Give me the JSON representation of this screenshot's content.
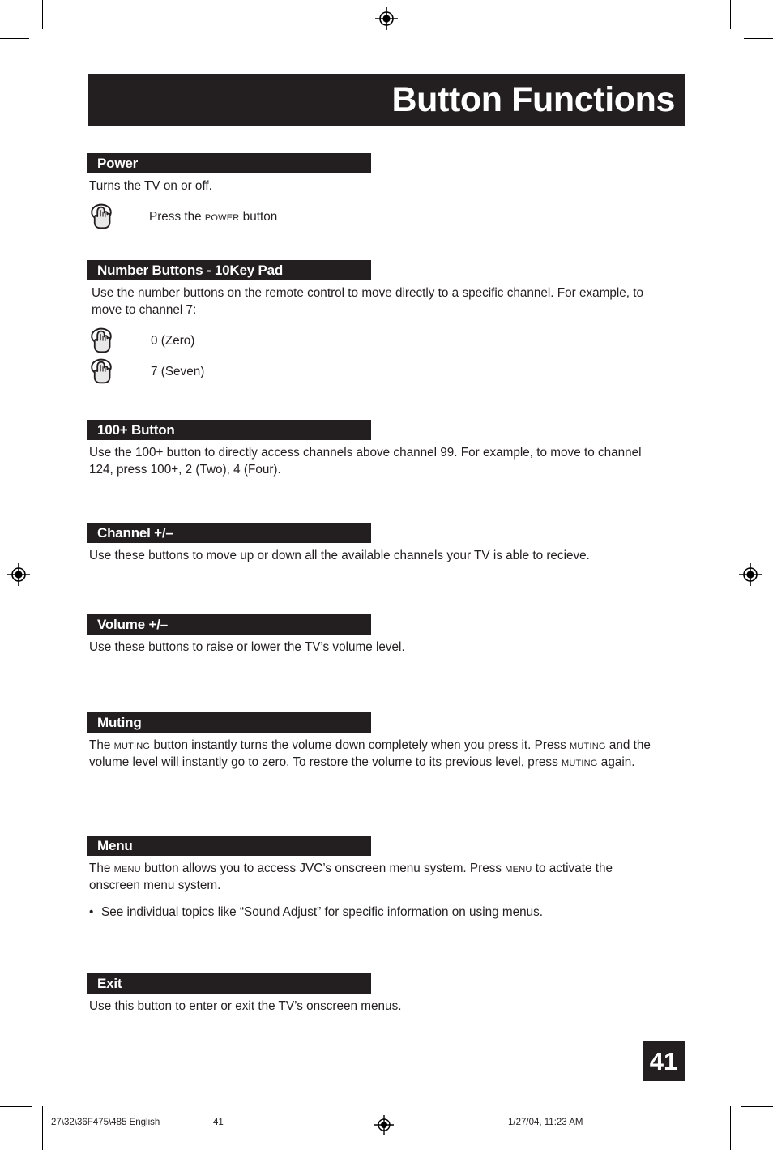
{
  "document": {
    "title": "Button Functions",
    "page_number": "41"
  },
  "sections": [
    {
      "id": "power",
      "heading": "Power",
      "body": "Turns the TV on or off.",
      "press_rows": [
        {
          "icon": "hand-press-icon",
          "label_pre": "Press the ",
          "label_sc": "Power",
          "label_post": " button"
        }
      ]
    },
    {
      "id": "number-buttons",
      "heading": "Number Buttons - 10Key Pad",
      "body": "Use the number buttons on the remote control to move directly to a specific channel. For example, to move to channel 7:",
      "press_rows": [
        {
          "icon": "hand-press-icon",
          "label": "0 (Zero)"
        },
        {
          "icon": "hand-press-icon",
          "label": "7 (Seven)"
        }
      ]
    },
    {
      "id": "hundred-plus-button",
      "heading": "100+ Button",
      "body": "Use the 100+ button to directly access channels above channel 99. For example, to move to channel 124, press 100+, 2 (Two), 4 (Four)."
    },
    {
      "id": "channel-plus-minus",
      "heading": "Channel +/–",
      "body": "Use these buttons to move up or down all the available channels your TV is able to recieve."
    },
    {
      "id": "volume-plus-minus",
      "heading": "Volume +/–",
      "body": "Use these buttons to raise or lower the TV’s volume level."
    },
    {
      "id": "muting",
      "heading": "Muting",
      "body_parts": [
        "The ",
        "Muting",
        " button instantly turns the volume down completely when you press it.  Press ",
        "Muting",
        " and the volume level will instantly go to zero. To restore the volume to its previous level, press ",
        "Muting",
        " again."
      ]
    },
    {
      "id": "menu",
      "heading": "Menu",
      "body_parts": [
        "The ",
        "Menu",
        " button allows you to access JVC’s onscreen menu system. Press ",
        "Menu",
        " to activate the onscreen menu system."
      ],
      "bullet": {
        "marker": "•",
        "text": "See individual topics like “Sound Adjust” for specific information on using menus."
      }
    },
    {
      "id": "exit",
      "heading": "Exit",
      "body": "Use this button to enter or exit  the TV’s onscreen menus."
    }
  ],
  "footer": {
    "file_label": "27\\32\\36F475\\485 English",
    "page_label": "41",
    "timestamp": "1/27/04, 11:23 AM"
  },
  "colors": {
    "ink": "#231f20",
    "paper": "#ffffff"
  },
  "icons": {
    "hand_press": "hand-press-icon",
    "registration": "registration-target-icon"
  }
}
